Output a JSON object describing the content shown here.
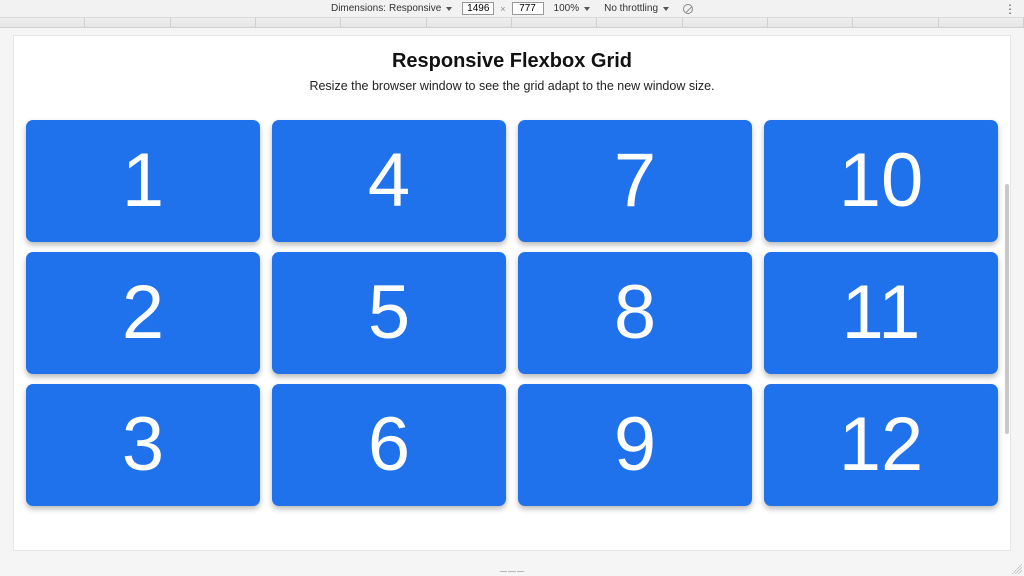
{
  "devbar": {
    "dimensions_label": "Dimensions:",
    "device_preset": "Responsive",
    "width_value": "1496",
    "height_value": "777",
    "zoom_label": "100%",
    "throttling_label": "No throttling"
  },
  "page": {
    "title": "Responsive Flexbox Grid",
    "subtitle": "Resize the browser window to see the grid adapt to the new window size."
  },
  "grid": {
    "columns": [
      [
        "1",
        "2",
        "3"
      ],
      [
        "4",
        "5",
        "6"
      ],
      [
        "7",
        "8",
        "9"
      ],
      [
        "10",
        "11",
        "12"
      ]
    ]
  },
  "colors": {
    "card_bg": "#1f72eb",
    "card_fg": "#ffffff"
  }
}
